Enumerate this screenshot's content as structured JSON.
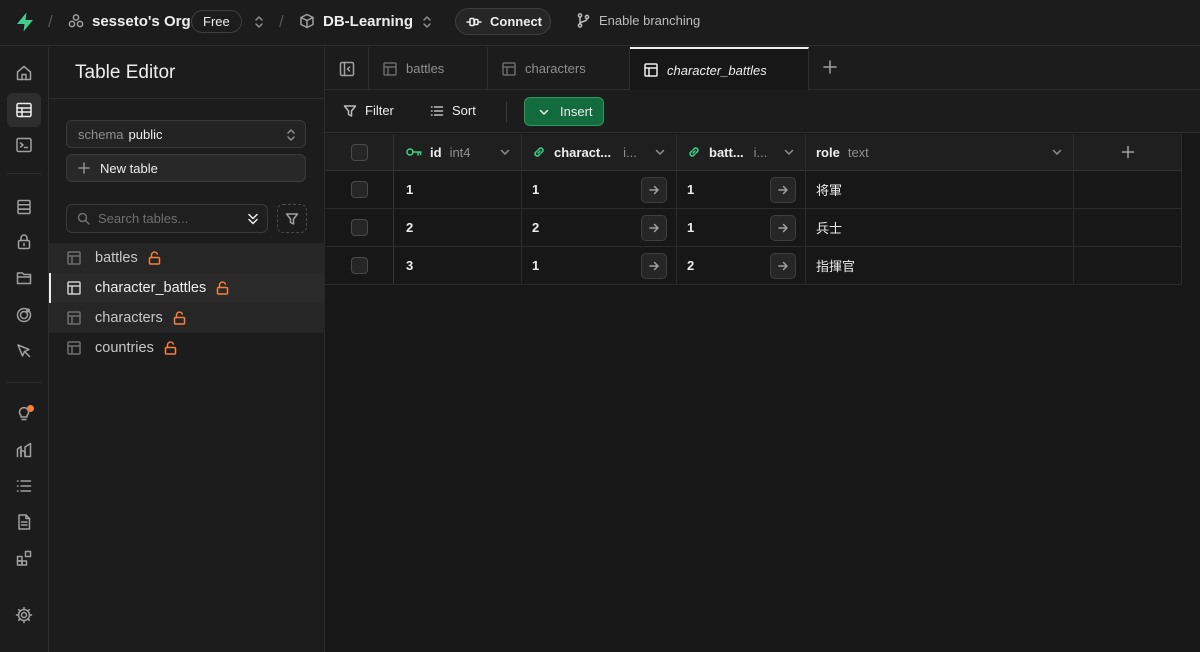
{
  "topbar": {
    "org_name": "sesseto's Org",
    "plan_badge": "Free",
    "project_name": "DB-Learning",
    "connect_label": "Connect",
    "branching_label": "Enable branching"
  },
  "sidebar": {
    "title": "Table Editor",
    "schema_key": "schema",
    "schema_value": "public",
    "new_table_label": "New table",
    "search_placeholder": "Search tables...",
    "tables": [
      {
        "name": "battles",
        "locked": true
      },
      {
        "name": "character_battles",
        "locked": true,
        "active": true
      },
      {
        "name": "characters",
        "locked": true
      },
      {
        "name": "countries",
        "locked": true
      }
    ]
  },
  "tabs": [
    {
      "label": "battles"
    },
    {
      "label": "characters"
    },
    {
      "label": "character_battles",
      "active": true
    }
  ],
  "toolbar": {
    "filter_label": "Filter",
    "sort_label": "Sort",
    "insert_label": "Insert"
  },
  "grid": {
    "columns": [
      {
        "name": "id",
        "type": "int4",
        "icon": "key-icon"
      },
      {
        "name": "charact...",
        "type": "i...",
        "icon": "link-icon"
      },
      {
        "name": "batt...",
        "type": "i...",
        "icon": "link-icon"
      },
      {
        "name": "role",
        "type": "text"
      }
    ],
    "rows": [
      [
        "1",
        "1",
        "1",
        "将軍"
      ],
      [
        "2",
        "2",
        "1",
        "兵士"
      ],
      [
        "3",
        "1",
        "2",
        "指揮官"
      ]
    ]
  },
  "colors": {
    "brand": "#3ecf8e",
    "insert_bg": "#126c3e",
    "lock": "#f3803f"
  }
}
